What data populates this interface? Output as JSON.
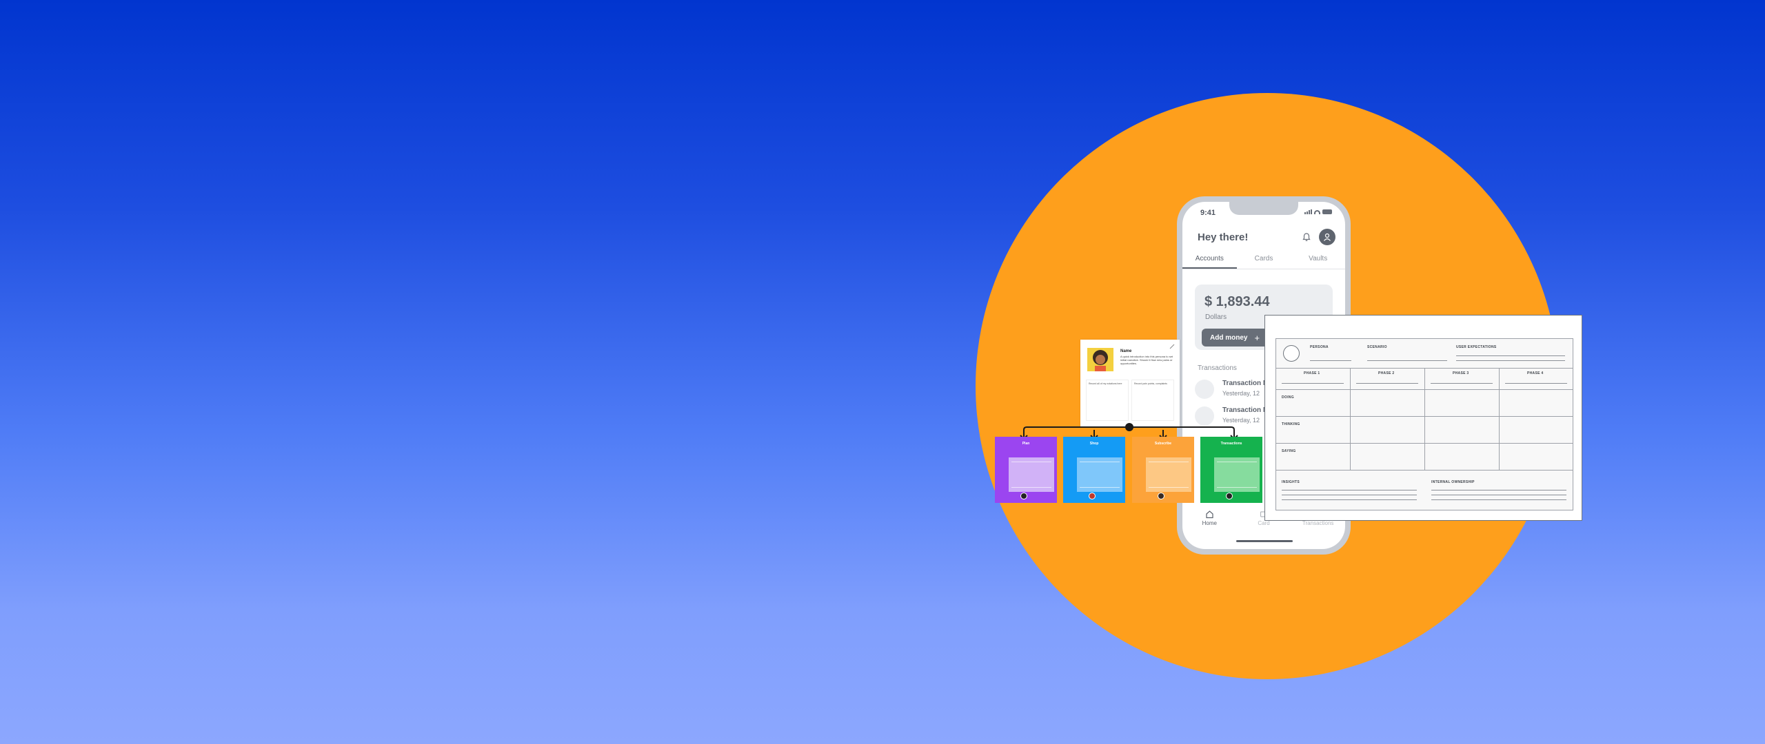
{
  "phone": {
    "status_time": "9:41",
    "greeting": "Hey there!",
    "tabs": [
      "Accounts",
      "Cards",
      "Vaults"
    ],
    "active_tab": "Accounts",
    "balance": "$ 1,893.44",
    "currency": "Dollars",
    "add_money_label": "Add money",
    "transactions_label": "Transactions",
    "transactions": [
      {
        "name": "Transaction N",
        "date": "Yesterday, 12"
      },
      {
        "name": "Transaction N",
        "date": "Yesterday, 12"
      }
    ],
    "nav": [
      "Home",
      "Card",
      "Transactions"
    ]
  },
  "persona_card": {
    "name": "Name",
    "description": "A quick introduction into this persona to set initial narrative. Should it flow new pains or opportunities.",
    "box_left": "Record all of my notations here",
    "box_right": "Record pain points, complaints"
  },
  "journey_cards": [
    {
      "title": "Plan",
      "color": "#9b45f0",
      "inner": "#d1b2f7"
    },
    {
      "title": "Shop",
      "color": "#149bf5",
      "inner": "#7fc7fa"
    },
    {
      "title": "Subscribe",
      "color": "#fca33a",
      "inner": "#fdc884"
    },
    {
      "title": "Transactions",
      "color": "#15b24e",
      "inner": "#86dc9e"
    }
  ],
  "journey_map": {
    "persona": "PERSONA",
    "scenario": "SCENARIO",
    "user_expectations": "USER EXPECTATIONS",
    "phases": [
      "PHASE 1",
      "PHASE 2",
      "PHASE 3",
      "PHASE 4"
    ],
    "rows": [
      "DOING",
      "THINKING",
      "SAYING"
    ],
    "insights": "INSIGHTS",
    "internal_ownership": "INTERNAL OWNERSHIP"
  },
  "colors": {
    "background_top": "#0135cf",
    "background_bottom": "#8ca7fe",
    "circle": "#fe9f1c"
  }
}
